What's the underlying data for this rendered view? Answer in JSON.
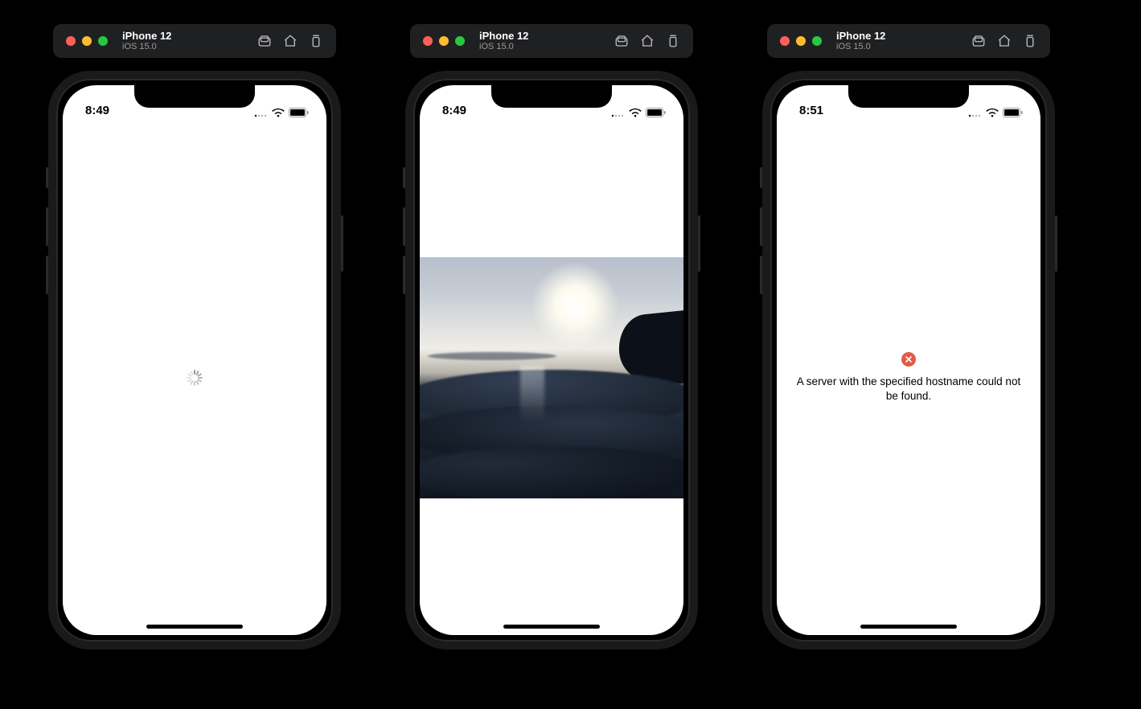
{
  "sims": [
    {
      "device": "iPhone 12",
      "os": "iOS 15.0",
      "time": "8:49",
      "state": "loading"
    },
    {
      "device": "iPhone 12",
      "os": "iOS 15.0",
      "time": "8:49",
      "state": "image"
    },
    {
      "device": "iPhone 12",
      "os": "iOS 15.0",
      "time": "8:51",
      "state": "error",
      "error_text": "A server with the specified hostname could not be found."
    }
  ]
}
